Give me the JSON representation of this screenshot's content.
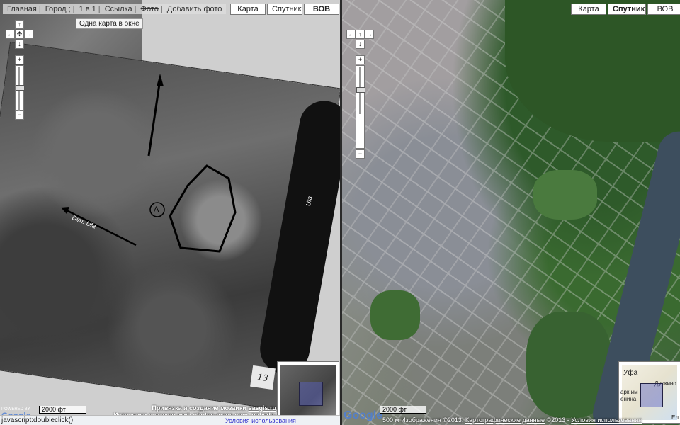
{
  "left_map": {
    "nav": {
      "home": "Главная",
      "city": "Город ;",
      "one_in_one": "1 в 1",
      "link": "Ссылка",
      "photo": "Фото",
      "add_photo": "Добавить фото",
      "tooltip": "Одна карта в окне"
    },
    "map_types": [
      "Карта",
      "Спутник",
      "ВОВ"
    ],
    "active_map_type": "ВОВ",
    "annotations": {
      "circle_letter": "A",
      "river_label": "Ufa",
      "arrow_text": "Dirn. Ufa",
      "photo_number": "13"
    },
    "credits": {
      "line1_prefix": "Привязка и создание мозаики ",
      "line1_link": "sasgis.ru",
      "line2_prefix": "Источники снимков ",
      "line2_link1": "wwii-photos-maps.com",
      "line2_sep": ", ",
      "line2_link2": "pobeda-info.ru"
    },
    "scale": "2000 фт",
    "powered_by": "POWERED BY",
    "google": "Google",
    "terms": "Условия использования",
    "status": "javascript:doubleclick();"
  },
  "right_map": {
    "map_types": [
      "Карта",
      "Спутник",
      "ВОВ"
    ],
    "active_map_type": "Спутник",
    "scale": "2000 фт",
    "google": "Google",
    "copyright_prefix": "500 м   Изображения ©2013, ",
    "copyright_link": "Картографические данные",
    "copyright_mid": " ©2013 - ",
    "copyright_terms": "Условия использования",
    "overview_labels": {
      "city": "Уфа",
      "park": "арк им",
      "park2": "енина",
      "district": "Дуркино",
      "edge": "Ел"
    }
  },
  "zoom": {
    "plus": "+",
    "minus": "−",
    "up": "↑",
    "down": "↓",
    "left": "←",
    "right": "→",
    "center": "✥"
  },
  "colors": {
    "button_border": "#777777",
    "credits_text": "#ffffff",
    "splitter": "#2a2a2a"
  }
}
